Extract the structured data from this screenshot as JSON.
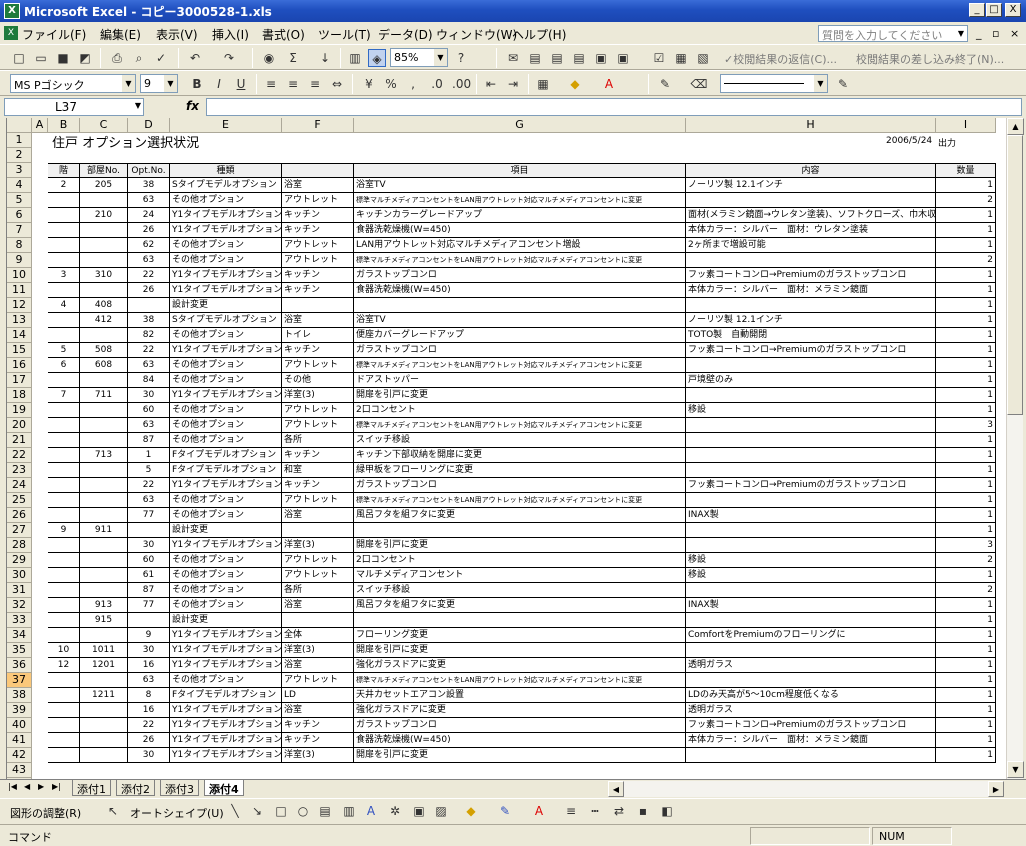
{
  "window": {
    "title": "Microsoft Excel - コピー3000528-1.xls",
    "app_icon_glyph": "X",
    "minimize": "_",
    "maximize": "□",
    "close": "X"
  },
  "menu": {
    "items": [
      "ファイル(F)",
      "編集(E)",
      "表示(V)",
      "挿入(I)",
      "書式(O)",
      "ツール(T)",
      "データ(D)",
      "ウィンドウ(W)",
      "ヘルプ(H)"
    ],
    "help_placeholder": "質問を入力してください",
    "mdi_minimize": "_",
    "mdi_restore": "▫",
    "mdi_close": "×"
  },
  "toolbar": {
    "zoom": "85%",
    "review_reply": "✓校閲結果の返信(C)...",
    "review_end": "校閲結果の差し込み終了(N)...",
    "font_name": "MS Pゴシック",
    "font_size": "9"
  },
  "formula_bar": {
    "name_box": "L37",
    "fx_label": "fx",
    "formula": ""
  },
  "columns": [
    "A",
    "B",
    "C",
    "D",
    "E",
    "F",
    "G",
    "H",
    "I"
  ],
  "sheet": {
    "title": "住戸 オプション選択状況",
    "date": "2006/5/24",
    "output_label": "出力",
    "headers": [
      "階",
      "部屋No.",
      "Opt.No.",
      "種類",
      "",
      "項目",
      "内容",
      "数量"
    ],
    "rows": [
      [
        "2",
        "205",
        "38",
        "Sタイプモデルオプション",
        "浴室",
        "浴室TV",
        "ノーリツ製 12.1インチ",
        "1"
      ],
      [
        "",
        "",
        "63",
        "その他オプション",
        "アウトレット",
        "標準マルチメディアコンセントをLAN用アウトレット対応マルチメディアコンセントに変更",
        "",
        "2"
      ],
      [
        "",
        "210",
        "24",
        "Y1タイプモデルオプション",
        "キッチン",
        "キッチンカラーグレードアップ",
        "面材(メラミン鏡面→ウレタン塗装)、ソフトクローズ、巾木収納",
        "1"
      ],
      [
        "",
        "",
        "26",
        "Y1タイプモデルオプション",
        "キッチン",
        "食器洗乾燥機(W=450)",
        "本体カラー：シルバー　面材：ウレタン塗装",
        "1"
      ],
      [
        "",
        "",
        "62",
        "その他オプション",
        "アウトレット",
        "LAN用アウトレット対応マルチメディアコンセント増設",
        "2ヶ所まで増設可能",
        "1"
      ],
      [
        "",
        "",
        "63",
        "その他オプション",
        "アウトレット",
        "標準マルチメディアコンセントをLAN用アウトレット対応マルチメディアコンセントに変更",
        "",
        "2"
      ],
      [
        "3",
        "310",
        "22",
        "Y1タイプモデルオプション",
        "キッチン",
        "ガラストップコンロ",
        "フッ素コートコンロ→Premiumのガラストップコンロ",
        "1"
      ],
      [
        "",
        "",
        "26",
        "Y1タイプモデルオプション",
        "キッチン",
        "食器洗乾燥機(W=450)",
        "本体カラー：シルバー　面材：メラミン鏡面",
        "1"
      ],
      [
        "4",
        "408",
        "",
        "設計変更",
        "",
        "",
        "",
        "1"
      ],
      [
        "",
        "412",
        "38",
        "Sタイプモデルオプション",
        "浴室",
        "浴室TV",
        "ノーリツ製 12.1インチ",
        "1"
      ],
      [
        "",
        "",
        "82",
        "その他オプション",
        "トイレ",
        "便座カバーグレードアップ",
        "TOTO製　自動開閉",
        "1"
      ],
      [
        "5",
        "508",
        "22",
        "Y1タイプモデルオプション",
        "キッチン",
        "ガラストップコンロ",
        "フッ素コートコンロ→Premiumのガラストップコンロ",
        "1"
      ],
      [
        "6",
        "608",
        "63",
        "その他オプション",
        "アウトレット",
        "標準マルチメディアコンセントをLAN用アウトレット対応マルチメディアコンセントに変更",
        "",
        "1"
      ],
      [
        "",
        "",
        "84",
        "その他オプション",
        "その他",
        "ドアストッパー",
        "戸境壁のみ",
        "1"
      ],
      [
        "7",
        "711",
        "30",
        "Y1タイプモデルオプション",
        "洋室(3)",
        "開扉を引戸に変更",
        "",
        "1"
      ],
      [
        "",
        "",
        "60",
        "その他オプション",
        "アウトレット",
        "2口コンセント",
        "移設",
        "1"
      ],
      [
        "",
        "",
        "63",
        "その他オプション",
        "アウトレット",
        "標準マルチメディアコンセントをLAN用アウトレット対応マルチメディアコンセントに変更",
        "",
        "3"
      ],
      [
        "",
        "",
        "87",
        "その他オプション",
        "各所",
        "スイッチ移設",
        "",
        "1"
      ],
      [
        "",
        "713",
        "1",
        "Fタイプモデルオプション",
        "キッチン",
        "キッチン下部収納を開扉に変更",
        "",
        "1"
      ],
      [
        "",
        "",
        "5",
        "Fタイプモデルオプション",
        "和室",
        "緑甲板をフローリングに変更",
        "",
        "1"
      ],
      [
        "",
        "",
        "22",
        "Y1タイプモデルオプション",
        "キッチン",
        "ガラストップコンロ",
        "フッ素コートコンロ→Premiumのガラストップコンロ",
        "1"
      ],
      [
        "",
        "",
        "63",
        "その他オプション",
        "アウトレット",
        "標準マルチメディアコンセントをLAN用アウトレット対応マルチメディアコンセントに変更",
        "",
        "1"
      ],
      [
        "",
        "",
        "77",
        "その他オプション",
        "浴室",
        "風呂フタを組フタに変更",
        "INAX製",
        "1"
      ],
      [
        "9",
        "911",
        "",
        "設計変更",
        "",
        "",
        "",
        "1"
      ],
      [
        "",
        "",
        "30",
        "Y1タイプモデルオプション",
        "洋室(3)",
        "開扉を引戸に変更",
        "",
        "3"
      ],
      [
        "",
        "",
        "60",
        "その他オプション",
        "アウトレット",
        "2口コンセント",
        "移設",
        "2"
      ],
      [
        "",
        "",
        "61",
        "その他オプション",
        "アウトレット",
        "マルチメディアコンセント",
        "移設",
        "1"
      ],
      [
        "",
        "",
        "87",
        "その他オプション",
        "各所",
        "スイッチ移設",
        "",
        "2"
      ],
      [
        "",
        "913",
        "77",
        "その他オプション",
        "浴室",
        "風呂フタを組フタに変更",
        "INAX製",
        "1"
      ],
      [
        "",
        "915",
        "",
        "設計変更",
        "",
        "",
        "",
        "1"
      ],
      [
        "",
        "",
        "9",
        "Y1タイプモデルオプション",
        "全体",
        "フローリング変更",
        "ComfortをPremiumのフローリングに",
        "1"
      ],
      [
        "10",
        "1011",
        "30",
        "Y1タイプモデルオプション",
        "洋室(3)",
        "開扉を引戸に変更",
        "",
        "1"
      ],
      [
        "12",
        "1201",
        "16",
        "Y1タイプモデルオプション",
        "浴室",
        "強化ガラスドアに変更",
        "透明ガラス",
        "1"
      ],
      [
        "",
        "",
        "63",
        "その他オプション",
        "アウトレット",
        "標準マルチメディアコンセントをLAN用アウトレット対応マルチメディアコンセントに変更",
        "",
        "1"
      ],
      [
        "",
        "1211",
        "8",
        "Fタイプモデルオプション",
        "LD",
        "天井カセットエアコン設置",
        "LDのみ天高が5～10cm程度低くなる",
        "1"
      ],
      [
        "",
        "",
        "16",
        "Y1タイプモデルオプション",
        "浴室",
        "強化ガラスドアに変更",
        "透明ガラス",
        "1"
      ],
      [
        "",
        "",
        "22",
        "Y1タイプモデルオプション",
        "キッチン",
        "ガラストップコンロ",
        "フッ素コートコンロ→Premiumのガラストップコンロ",
        "1"
      ],
      [
        "",
        "",
        "26",
        "Y1タイプモデルオプション",
        "キッチン",
        "食器洗乾燥機(W=450)",
        "本体カラー：シルバー　面材：メラミン鏡面",
        "1"
      ],
      [
        "",
        "",
        "30",
        "Y1タイプモデルオプション",
        "洋室(3)",
        "開扉を引戸に変更",
        "",
        "1"
      ]
    ]
  },
  "tabs": [
    "添付1",
    "添付2",
    "添付3",
    "添付4"
  ],
  "active_tab": "添付4",
  "drawbar": {
    "adjust": "図形の調整(R)",
    "autoshape": "オートシェイプ(U)"
  },
  "status": {
    "mode": "コマンド",
    "num": "NUM"
  },
  "colors": {
    "titlebar": "#1f4fbf",
    "selected_row": "#fbc87a",
    "chrome": "#ece9d8"
  }
}
